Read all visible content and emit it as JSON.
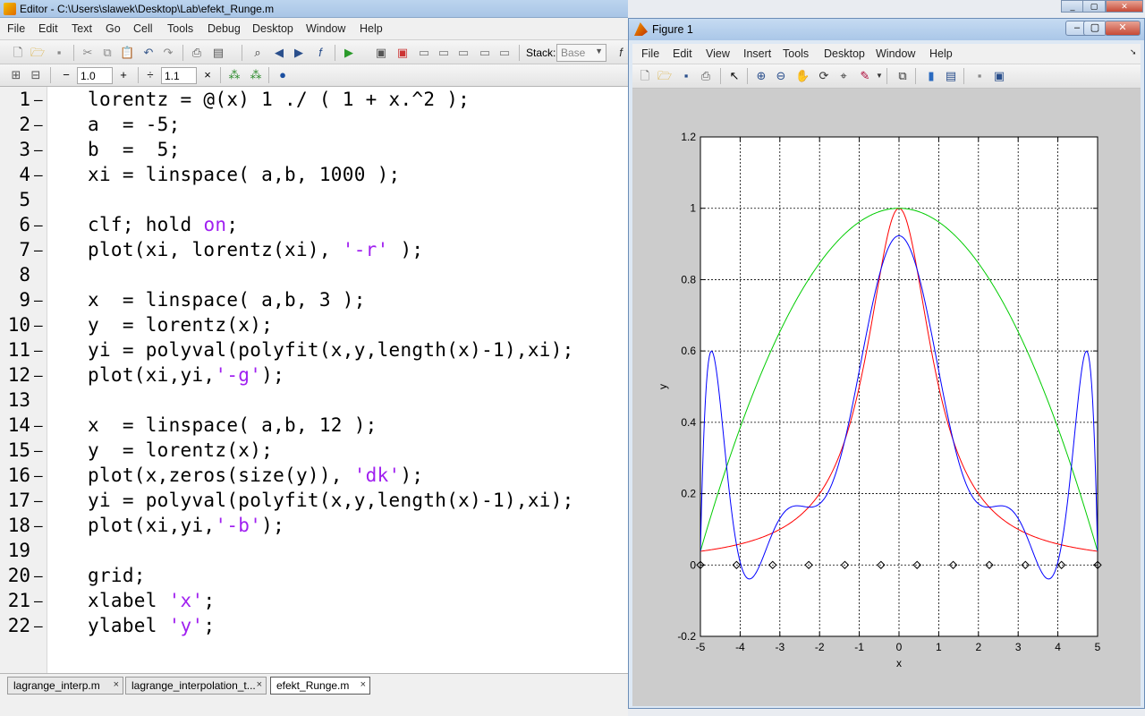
{
  "editor": {
    "title": "Editor - C:\\Users\\slawek\\Desktop\\Lab\\efekt_Runge.m",
    "menu": [
      "File",
      "Edit",
      "Text",
      "Go",
      "Cell",
      "Tools",
      "Debug",
      "Desktop",
      "Window",
      "Help"
    ],
    "stack_label": "Stack:",
    "stack_value": "Base",
    "cell_toolbar": {
      "minus": "−",
      "value1": "1.0",
      "plus": "+",
      "divide": "÷",
      "value2": "1.1",
      "times": "×"
    },
    "lines": [
      {
        "n": "1",
        "parts": [
          {
            "t": "lorentz = @(x) 1 ./ ( 1 + x.^2 );"
          }
        ]
      },
      {
        "n": "2",
        "parts": [
          {
            "t": "a  = -5;"
          }
        ]
      },
      {
        "n": "3",
        "parts": [
          {
            "t": "b  =  5;"
          }
        ]
      },
      {
        "n": "4",
        "parts": [
          {
            "t": "xi = linspace( a,b, 1000 );"
          }
        ]
      },
      {
        "n": "5",
        "parts": [],
        "nodash": true
      },
      {
        "n": "6",
        "parts": [
          {
            "t": "clf; hold "
          },
          {
            "t": "on",
            "s": true
          },
          {
            "t": ";"
          }
        ]
      },
      {
        "n": "7",
        "parts": [
          {
            "t": "plot(xi, lorentz(xi), "
          },
          {
            "t": "'-r'",
            "s": true
          },
          {
            "t": " );"
          }
        ]
      },
      {
        "n": "8",
        "parts": [],
        "nodash": true
      },
      {
        "n": "9",
        "parts": [
          {
            "t": "x  = linspace( a,b, 3 );"
          }
        ]
      },
      {
        "n": "10",
        "parts": [
          {
            "t": "y  = lorentz(x);"
          }
        ]
      },
      {
        "n": "11",
        "parts": [
          {
            "t": "yi = polyval(polyfit(x,y,length(x)-1),xi);"
          }
        ]
      },
      {
        "n": "12",
        "parts": [
          {
            "t": "plot(xi,yi,"
          },
          {
            "t": "'-g'",
            "s": true
          },
          {
            "t": ");"
          }
        ]
      },
      {
        "n": "13",
        "parts": [],
        "nodash": true
      },
      {
        "n": "14",
        "parts": [
          {
            "t": "x  = linspace( a,b, 12 );"
          }
        ]
      },
      {
        "n": "15",
        "parts": [
          {
            "t": "y  = lorentz(x);"
          }
        ]
      },
      {
        "n": "16",
        "parts": [
          {
            "t": "plot(x,zeros(size(y)), "
          },
          {
            "t": "'dk'",
            "s": true
          },
          {
            "t": ");"
          }
        ]
      },
      {
        "n": "17",
        "parts": [
          {
            "t": "yi = polyval(polyfit(x,y,length(x)-1),xi);"
          }
        ]
      },
      {
        "n": "18",
        "parts": [
          {
            "t": "plot(xi,yi,"
          },
          {
            "t": "'-b'",
            "s": true
          },
          {
            "t": ");"
          }
        ]
      },
      {
        "n": "19",
        "parts": [],
        "nodash": true
      },
      {
        "n": "20",
        "parts": [
          {
            "t": "grid;"
          }
        ]
      },
      {
        "n": "21",
        "parts": [
          {
            "t": "xlabel "
          },
          {
            "t": "'x'",
            "s": true
          },
          {
            "t": ";"
          }
        ]
      },
      {
        "n": "22",
        "parts": [
          {
            "t": "ylabel "
          },
          {
            "t": "'y'",
            "s": true
          },
          {
            "t": ";"
          }
        ]
      }
    ],
    "tabs": [
      {
        "label": "lagrange_interp.m",
        "active": false
      },
      {
        "label": "lagrange_interpolation_t...",
        "active": false
      },
      {
        "label": "efekt_Runge.m",
        "active": true
      }
    ],
    "string_color": "#a020f0"
  },
  "figure": {
    "title": "Figure 1",
    "menu": [
      "File",
      "Edit",
      "View",
      "Insert",
      "Tools",
      "Desktop",
      "Window",
      "Help"
    ],
    "chart_data": {
      "type": "line",
      "xlabel": "x",
      "ylabel": "y",
      "xlim": [
        -5,
        5
      ],
      "ylim": [
        -0.2,
        1.2
      ],
      "xticks": [
        "-5",
        "-4",
        "-3",
        "-2",
        "-1",
        "0",
        "1",
        "2",
        "3",
        "4",
        "5"
      ],
      "yticks": [
        "-0.2",
        "0",
        "0.2",
        "0.4",
        "0.6",
        "0.8",
        "1",
        "1.2"
      ],
      "grid": true,
      "series": [
        {
          "color": "#ff0000",
          "expr": "1/(1+x^2)",
          "npoints": 1000
        },
        {
          "color": "#00cc00",
          "expr": "polyfit deg 2 through 3 nodes",
          "npoints": 1000
        },
        {
          "color": "#0000ff",
          "expr": "polyfit deg 11 through 12 nodes",
          "npoints": 1000
        }
      ],
      "markers": {
        "color": "#000000",
        "shape": "diamond",
        "x": [
          -5,
          -4.0909,
          -3.1818,
          -2.2727,
          -1.3636,
          -0.4545,
          0.4545,
          1.3636,
          2.2727,
          3.1818,
          4.0909,
          5
        ],
        "y": [
          0,
          0,
          0,
          0,
          0,
          0,
          0,
          0,
          0,
          0,
          0,
          0
        ]
      }
    }
  }
}
